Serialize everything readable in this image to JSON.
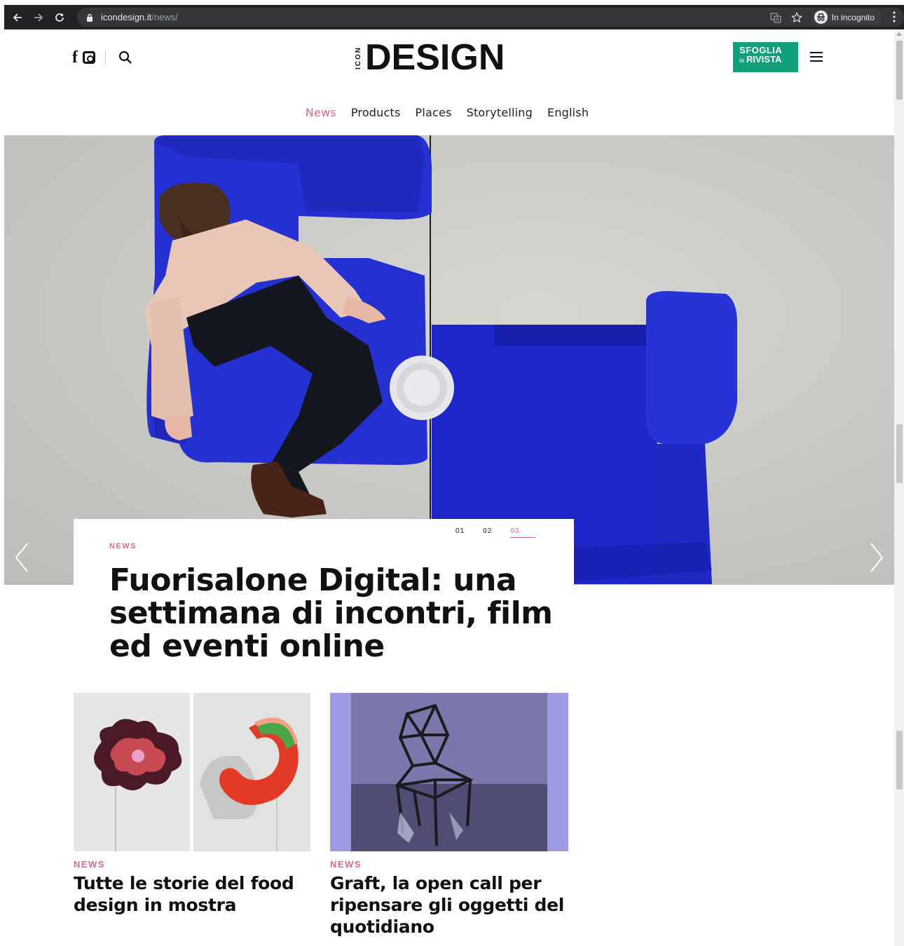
{
  "browser": {
    "url_host": "icondesign.it",
    "url_path": "/news/",
    "incognito_label": "In incognito",
    "icons": [
      "back-arrow-icon",
      "forward-arrow-icon",
      "reload-icon",
      "lock-icon",
      "translate-icon",
      "star-icon",
      "incognito-icon",
      "kebab-menu-icon"
    ]
  },
  "header": {
    "logo_small": "ICON",
    "logo_main": "DESIGN",
    "facebook": "f",
    "cta_line1": "SFOGLIA",
    "cta_line2_small": "la",
    "cta_line2": "RIVISTA",
    "accent_color": "#d06f8b",
    "cta_color": "#0f9f7a"
  },
  "nav": {
    "items": [
      {
        "label": "News",
        "active": true
      },
      {
        "label": "Products",
        "active": false
      },
      {
        "label": "Places",
        "active": false
      },
      {
        "label": "Storytelling",
        "active": false
      },
      {
        "label": "English",
        "active": false
      }
    ]
  },
  "hero": {
    "category": "NEWS",
    "title": "Fuorisalone Digital: una settimana di incontri, film ed eventi online",
    "pager": [
      "01",
      "02",
      "03"
    ],
    "active_slide": "03"
  },
  "cards": [
    {
      "category": "NEWS",
      "title": "Tutte le storie del food design in mostra"
    },
    {
      "category": "NEWS",
      "title": "Graft, la open call per ripensare gli oggetti del quotidiano"
    }
  ]
}
